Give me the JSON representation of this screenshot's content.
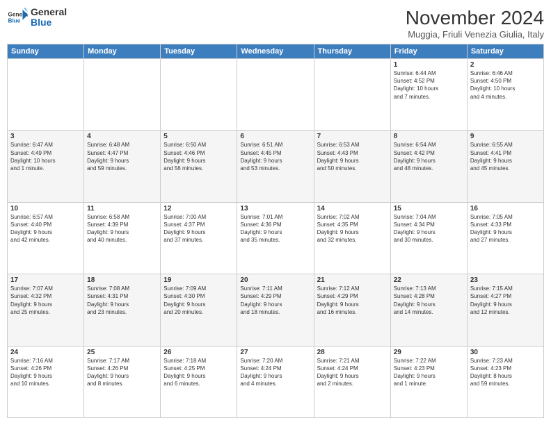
{
  "logo": {
    "general": "General",
    "blue": "Blue"
  },
  "header": {
    "month": "November 2024",
    "location": "Muggia, Friuli Venezia Giulia, Italy"
  },
  "weekdays": [
    "Sunday",
    "Monday",
    "Tuesday",
    "Wednesday",
    "Thursday",
    "Friday",
    "Saturday"
  ],
  "rows": [
    {
      "style": "white",
      "cells": [
        {
          "day": "",
          "info": ""
        },
        {
          "day": "",
          "info": ""
        },
        {
          "day": "",
          "info": ""
        },
        {
          "day": "",
          "info": ""
        },
        {
          "day": "",
          "info": ""
        },
        {
          "day": "1",
          "info": "Sunrise: 6:44 AM\nSunset: 4:52 PM\nDaylight: 10 hours\nand 7 minutes."
        },
        {
          "day": "2",
          "info": "Sunrise: 6:46 AM\nSunset: 4:50 PM\nDaylight: 10 hours\nand 4 minutes."
        }
      ]
    },
    {
      "style": "gray",
      "cells": [
        {
          "day": "3",
          "info": "Sunrise: 6:47 AM\nSunset: 4:49 PM\nDaylight: 10 hours\nand 1 minute."
        },
        {
          "day": "4",
          "info": "Sunrise: 6:48 AM\nSunset: 4:47 PM\nDaylight: 9 hours\nand 59 minutes."
        },
        {
          "day": "5",
          "info": "Sunrise: 6:50 AM\nSunset: 4:46 PM\nDaylight: 9 hours\nand 56 minutes."
        },
        {
          "day": "6",
          "info": "Sunrise: 6:51 AM\nSunset: 4:45 PM\nDaylight: 9 hours\nand 53 minutes."
        },
        {
          "day": "7",
          "info": "Sunrise: 6:53 AM\nSunset: 4:43 PM\nDaylight: 9 hours\nand 50 minutes."
        },
        {
          "day": "8",
          "info": "Sunrise: 6:54 AM\nSunset: 4:42 PM\nDaylight: 9 hours\nand 48 minutes."
        },
        {
          "day": "9",
          "info": "Sunrise: 6:55 AM\nSunset: 4:41 PM\nDaylight: 9 hours\nand 45 minutes."
        }
      ]
    },
    {
      "style": "white",
      "cells": [
        {
          "day": "10",
          "info": "Sunrise: 6:57 AM\nSunset: 4:40 PM\nDaylight: 9 hours\nand 42 minutes."
        },
        {
          "day": "11",
          "info": "Sunrise: 6:58 AM\nSunset: 4:39 PM\nDaylight: 9 hours\nand 40 minutes."
        },
        {
          "day": "12",
          "info": "Sunrise: 7:00 AM\nSunset: 4:37 PM\nDaylight: 9 hours\nand 37 minutes."
        },
        {
          "day": "13",
          "info": "Sunrise: 7:01 AM\nSunset: 4:36 PM\nDaylight: 9 hours\nand 35 minutes."
        },
        {
          "day": "14",
          "info": "Sunrise: 7:02 AM\nSunset: 4:35 PM\nDaylight: 9 hours\nand 32 minutes."
        },
        {
          "day": "15",
          "info": "Sunrise: 7:04 AM\nSunset: 4:34 PM\nDaylight: 9 hours\nand 30 minutes."
        },
        {
          "day": "16",
          "info": "Sunrise: 7:05 AM\nSunset: 4:33 PM\nDaylight: 9 hours\nand 27 minutes."
        }
      ]
    },
    {
      "style": "gray",
      "cells": [
        {
          "day": "17",
          "info": "Sunrise: 7:07 AM\nSunset: 4:32 PM\nDaylight: 9 hours\nand 25 minutes."
        },
        {
          "day": "18",
          "info": "Sunrise: 7:08 AM\nSunset: 4:31 PM\nDaylight: 9 hours\nand 23 minutes."
        },
        {
          "day": "19",
          "info": "Sunrise: 7:09 AM\nSunset: 4:30 PM\nDaylight: 9 hours\nand 20 minutes."
        },
        {
          "day": "20",
          "info": "Sunrise: 7:11 AM\nSunset: 4:29 PM\nDaylight: 9 hours\nand 18 minutes."
        },
        {
          "day": "21",
          "info": "Sunrise: 7:12 AM\nSunset: 4:29 PM\nDaylight: 9 hours\nand 16 minutes."
        },
        {
          "day": "22",
          "info": "Sunrise: 7:13 AM\nSunset: 4:28 PM\nDaylight: 9 hours\nand 14 minutes."
        },
        {
          "day": "23",
          "info": "Sunrise: 7:15 AM\nSunset: 4:27 PM\nDaylight: 9 hours\nand 12 minutes."
        }
      ]
    },
    {
      "style": "white",
      "cells": [
        {
          "day": "24",
          "info": "Sunrise: 7:16 AM\nSunset: 4:26 PM\nDaylight: 9 hours\nand 10 minutes."
        },
        {
          "day": "25",
          "info": "Sunrise: 7:17 AM\nSunset: 4:26 PM\nDaylight: 9 hours\nand 8 minutes."
        },
        {
          "day": "26",
          "info": "Sunrise: 7:18 AM\nSunset: 4:25 PM\nDaylight: 9 hours\nand 6 minutes."
        },
        {
          "day": "27",
          "info": "Sunrise: 7:20 AM\nSunset: 4:24 PM\nDaylight: 9 hours\nand 4 minutes."
        },
        {
          "day": "28",
          "info": "Sunrise: 7:21 AM\nSunset: 4:24 PM\nDaylight: 9 hours\nand 2 minutes."
        },
        {
          "day": "29",
          "info": "Sunrise: 7:22 AM\nSunset: 4:23 PM\nDaylight: 9 hours\nand 1 minute."
        },
        {
          "day": "30",
          "info": "Sunrise: 7:23 AM\nSunset: 4:23 PM\nDaylight: 8 hours\nand 59 minutes."
        }
      ]
    }
  ]
}
